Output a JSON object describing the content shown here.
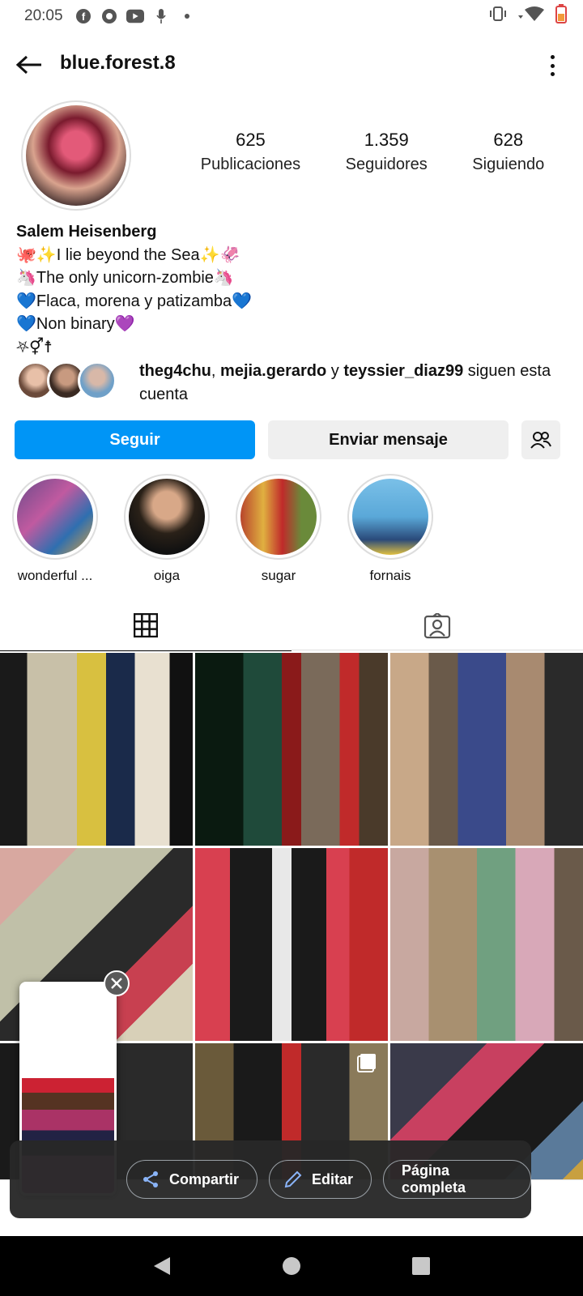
{
  "status_bar": {
    "time": "20:05"
  },
  "header": {
    "username": "blue.forest.8"
  },
  "profile": {
    "stats": [
      {
        "value": "625",
        "label": "Publicaciones"
      },
      {
        "value": "1.359",
        "label": "Seguidores"
      },
      {
        "value": "628",
        "label": "Siguiendo"
      }
    ],
    "name": "Salem Heisenberg",
    "bio_lines": [
      "🐙✨I lie beyond the Sea✨🦑",
      "🦄The only unicorn-zombie🦄",
      "💙Flaca, morena y patizamba💙",
      "💙Non binary💜",
      "⛧⚥☨"
    ],
    "followed_by": {
      "user1": "theg4chu",
      "sep1": ", ",
      "user2": "mejia.gerardo",
      "sep2": " y ",
      "user3": "teyssier_diaz99",
      "suffix": " siguen esta cuenta"
    }
  },
  "actions": {
    "follow": "Seguir",
    "message": "Enviar mensaje"
  },
  "highlights": [
    {
      "label": "wonderful ...",
      "color": "#6b4a8a"
    },
    {
      "label": "oiga",
      "color": "#2a2118"
    },
    {
      "label": "sugar",
      "color": "#b8452c"
    },
    {
      "label": "fornais",
      "color": "#5aa8d8"
    }
  ],
  "screenshot_toolbar": {
    "share": "Compartir",
    "edit": "Editar",
    "full_page": "Página completa"
  }
}
